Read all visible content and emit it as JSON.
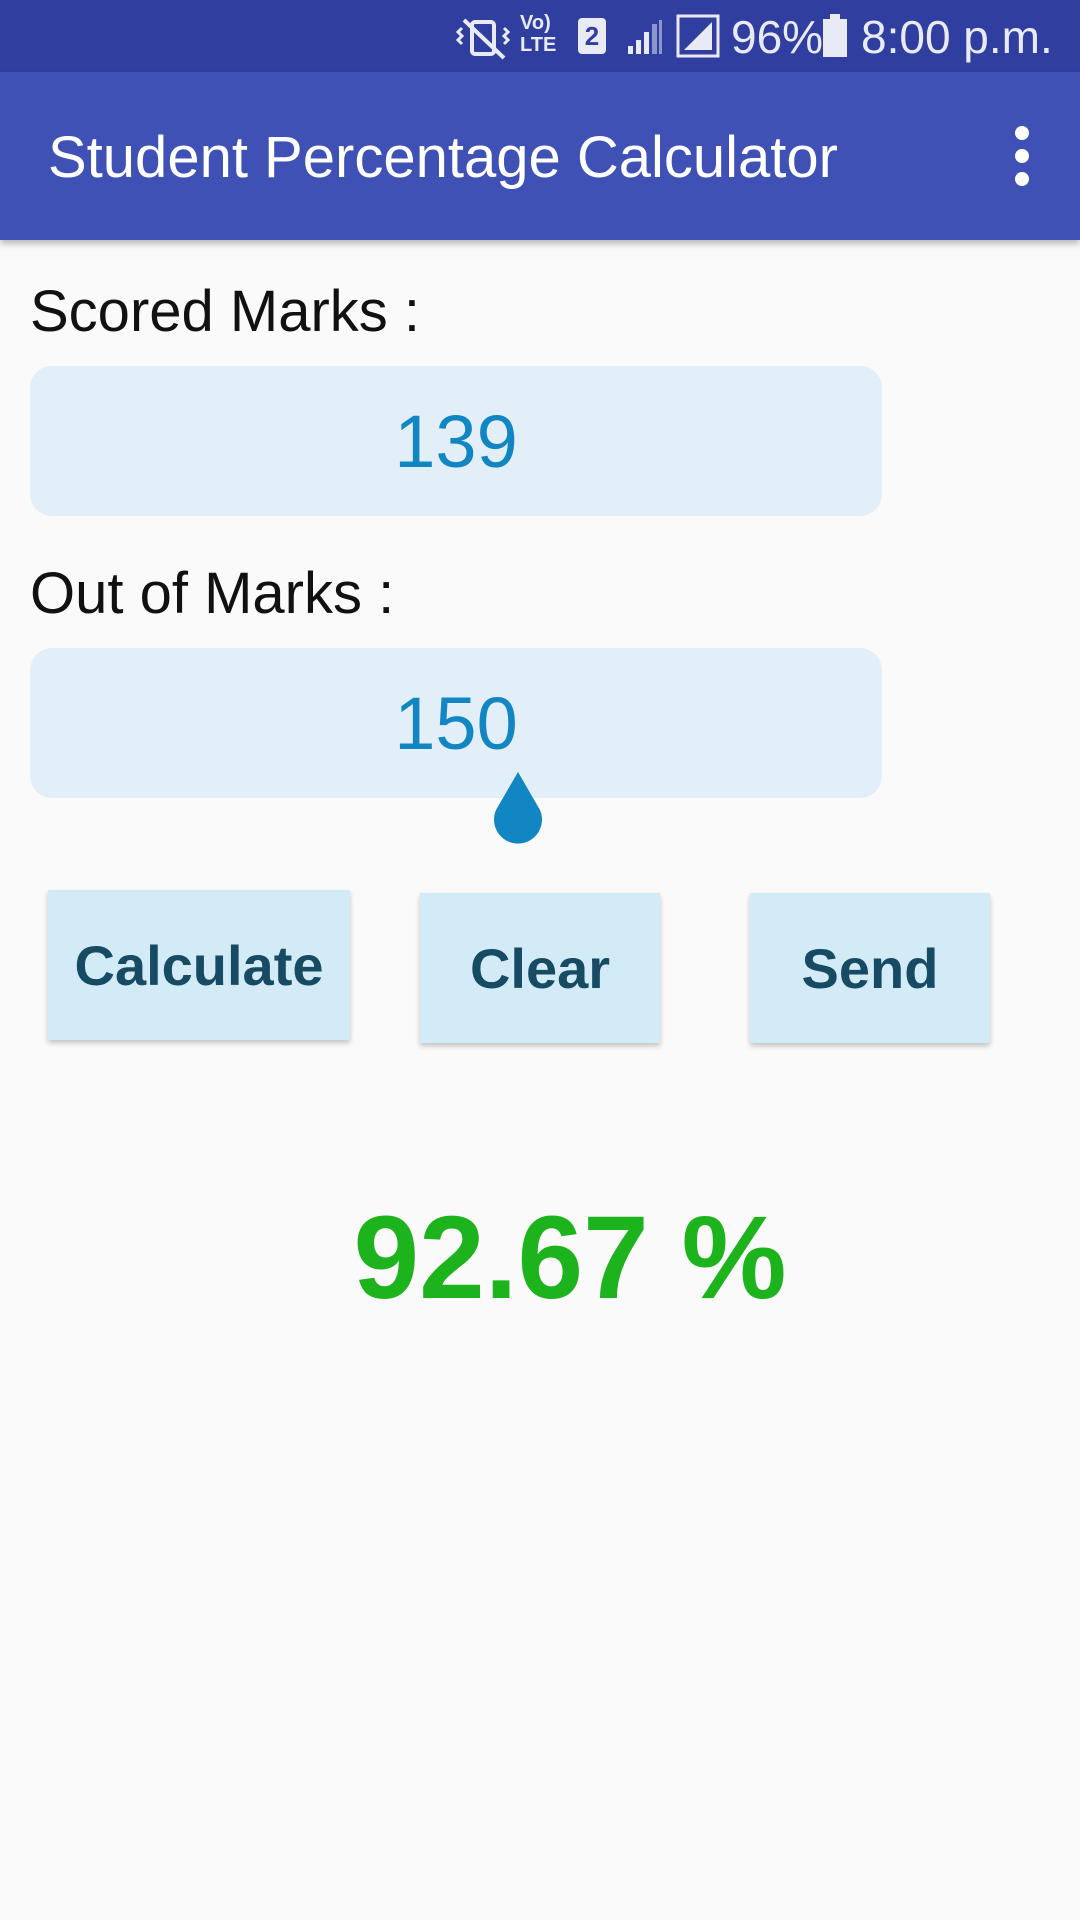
{
  "status_bar": {
    "battery_percent": "96%",
    "time": "8:00 p.m.",
    "sim_slot": "2",
    "network_label_top": "Vo)",
    "network_label_bottom": "LTE",
    "icons": [
      "vibrate-mute-icon",
      "volte-icon",
      "sim-2-icon",
      "signal-icon",
      "signal-icon",
      "battery-icon"
    ]
  },
  "app_bar": {
    "title": "Student Percentage Calculator",
    "menu_icon": "overflow-menu-icon"
  },
  "form": {
    "scored_label": "Scored Marks :",
    "scored_value": "139",
    "out_of_label": "Out of Marks  :",
    "out_of_value": "150"
  },
  "buttons": {
    "calculate": "Calculate",
    "clear": "Clear",
    "send": "Send"
  },
  "result": {
    "text": "92.67 %",
    "color": "#1db31d"
  },
  "colors": {
    "status_bar": "#303f9f",
    "app_bar": "#3f51b5",
    "field_bg": "#e2eff9",
    "field_text": "#1286c2",
    "button_bg": "#d3ebf6",
    "button_text": "#174a63"
  }
}
